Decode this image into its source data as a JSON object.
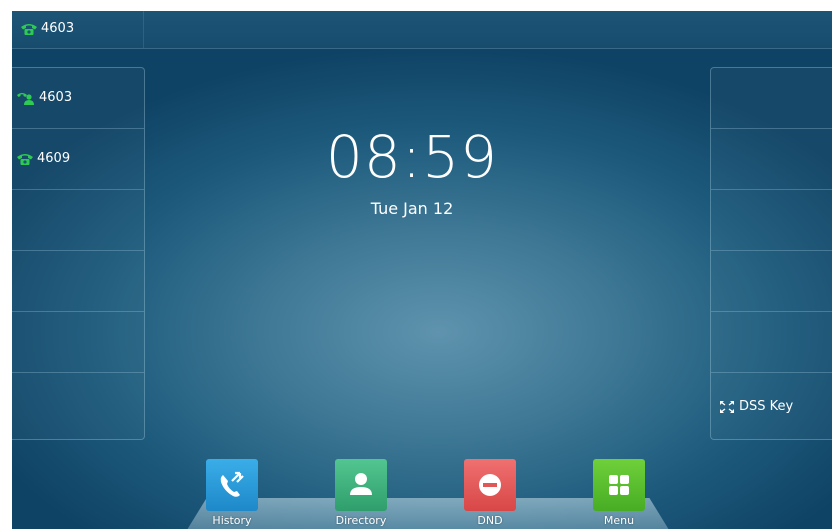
{
  "status_bar": {
    "account": "4603"
  },
  "line_keys": [
    {
      "label": "4603",
      "icon": "account-registered-icon"
    },
    {
      "label": "4609",
      "icon": "phone-icon"
    },
    {
      "label": ""
    },
    {
      "label": ""
    },
    {
      "label": ""
    },
    {
      "label": ""
    }
  ],
  "right_keys": [
    {
      "label": ""
    },
    {
      "label": ""
    },
    {
      "label": ""
    },
    {
      "label": ""
    },
    {
      "label": ""
    },
    {
      "label": "DSS Key",
      "icon": "expand-icon"
    }
  ],
  "clock": {
    "time": "08:59",
    "date": "Tue Jan 12"
  },
  "softkeys": [
    {
      "label": "History",
      "color": "#2a9ad8"
    },
    {
      "label": "Directory",
      "color": "#3fb27f"
    },
    {
      "label": "DND",
      "color": "#e65a5a"
    },
    {
      "label": "Menu",
      "color": "#5bbf2f"
    }
  ],
  "colors": {
    "phone_icon": "#2ecb52"
  }
}
